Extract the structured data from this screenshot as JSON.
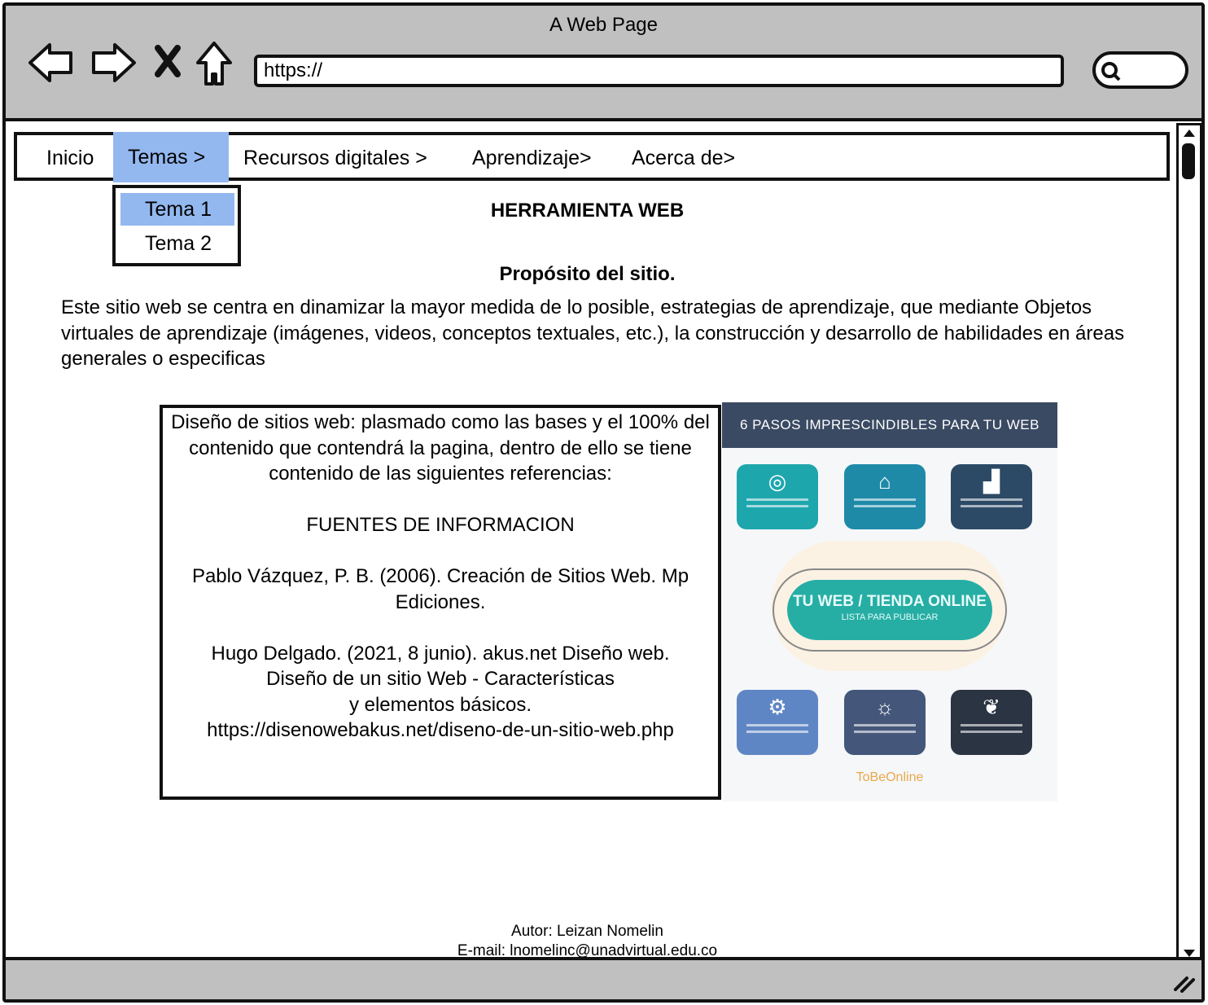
{
  "browser": {
    "title": "A Web Page",
    "url": "https://",
    "icons": [
      "back-arrow-icon",
      "forward-arrow-icon",
      "stop-x-icon",
      "home-icon",
      "search-icon"
    ]
  },
  "menu": {
    "items": [
      {
        "label": "Inicio"
      },
      {
        "label": "Temas >"
      },
      {
        "label": "Recursos digitales >"
      },
      {
        "label": "Aprendizaje>"
      },
      {
        "label": "Acerca de>"
      }
    ],
    "selected": "Temas >",
    "dropdown": [
      {
        "label": "Tema 1"
      },
      {
        "label": "Tema 2"
      }
    ],
    "highlight_color": "#93b8f0"
  },
  "content": {
    "heading": "HERRAMIENTA WEB",
    "subheading": "Propósito del sitio.",
    "paragraph": "Este sitio web se centra en dinamizar la mayor medida de lo posible, estrategias de aprendizaje, que mediante Objetos virtuales de aprendizaje (imágenes, videos, conceptos textuales, etc.), la construcción y desarrollo de habilidades en áreas generales o especificas",
    "box": {
      "intro": "Diseño de sitios web: plasmado como las bases y el 100% del contenido que contendrá la pagina, dentro de ello se tiene contenido de las siguientes referencias:",
      "sources_title": "FUENTES DE INFORMACION",
      "ref1": "Pablo Vázquez, P. B. (2006). Creación de Sitios Web. Mp Ediciones.",
      "ref2_line1": "Hugo Delgado. (2021, 8 junio). akus.net Diseño web.",
      "ref2_line2": "Diseño de un sitio Web - Características",
      "ref2_line3": "y elementos básicos.",
      "ref2_url": "https://disenowebakus.net/diseno-de-un-sitio-web.php"
    },
    "image": {
      "title": "6 PASOS IMPRESCINDIBLES PARA TU WEB",
      "center_title": "TU WEB / TIENDA ONLINE",
      "center_subtitle": "LISTA PARA PUBLICAR",
      "logo": "ToBeOnline",
      "cards": [
        {
          "icon": "target-icon",
          "color": "#1ea6ad"
        },
        {
          "icon": "house-icon",
          "color": "#1f8aa8"
        },
        {
          "icon": "chart-icon",
          "color": "#2c4a66"
        },
        {
          "icon": "gears-icon",
          "color": "#5f86c4"
        },
        {
          "icon": "lightbulb-icon",
          "color": "#44577a"
        },
        {
          "icon": "plant-hand-icon",
          "color": "#2a3443"
        }
      ]
    }
  },
  "footer": {
    "author": "Autor: Leizan Nomelin",
    "email": "E-mail: lnomelinc@unadvirtual.edu.co"
  }
}
